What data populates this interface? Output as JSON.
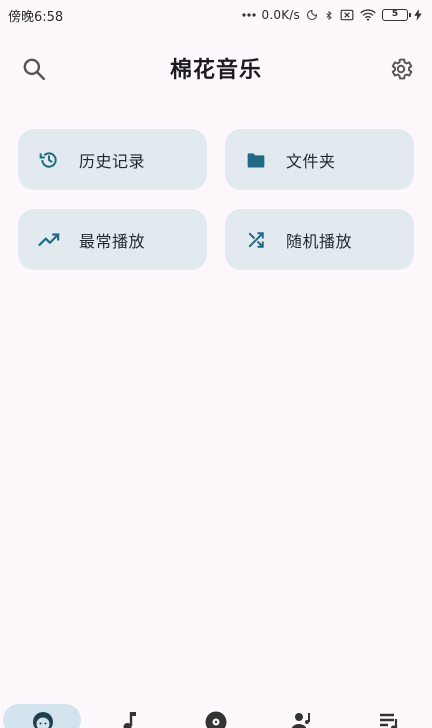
{
  "status_bar": {
    "time": "傍晚6:58",
    "net_speed": "0.0K/s",
    "battery": "5"
  },
  "app_bar": {
    "title": "棉花音乐",
    "search_icon": "search-icon",
    "settings_icon": "gear-icon"
  },
  "quick_actions": [
    {
      "label": "历史记录",
      "icon": "history-icon"
    },
    {
      "label": "文件夹",
      "icon": "folder-icon"
    },
    {
      "label": "最常播放",
      "icon": "trending-up-icon"
    },
    {
      "label": "随机播放",
      "icon": "shuffle-icon"
    }
  ],
  "bottom_nav": [
    {
      "icon": "face-icon",
      "active": true
    },
    {
      "icon": "music-note-icon",
      "active": false
    },
    {
      "icon": "album-icon",
      "active": false
    },
    {
      "icon": "artist-icon",
      "active": false
    },
    {
      "icon": "playlist-icon",
      "active": false
    }
  ],
  "colors": {
    "background": "#fdf8fc",
    "card": "#e2eaef",
    "accent": "#1f6a85",
    "active_pill": "#d3e4ee"
  }
}
